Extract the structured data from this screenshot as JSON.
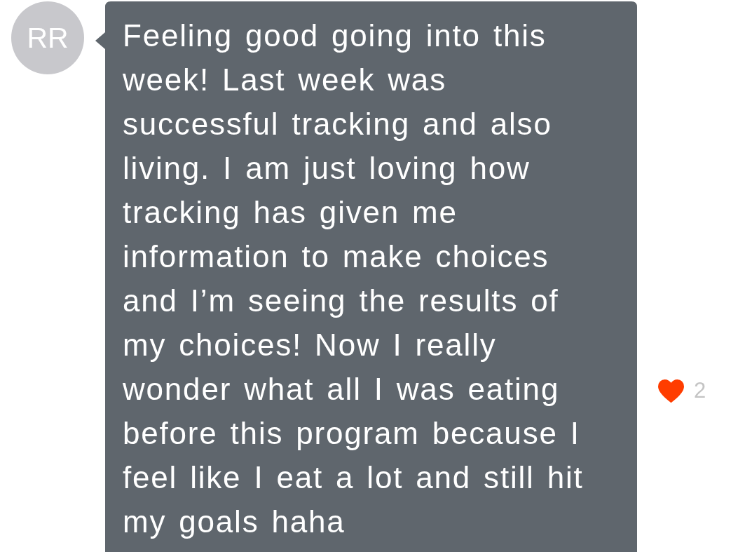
{
  "message": {
    "avatar": {
      "initials": "RR"
    },
    "text": "Feeling good going into this week! Last week was successful tracking and also living. I am just loving how tracking has given me information to make choices and I’m seeing the results of my choices! Now I really wonder what all I was eating before this program because I feel like I eat a lot and still hit my goals haha",
    "likes": {
      "liked": true,
      "count": "2"
    }
  }
}
